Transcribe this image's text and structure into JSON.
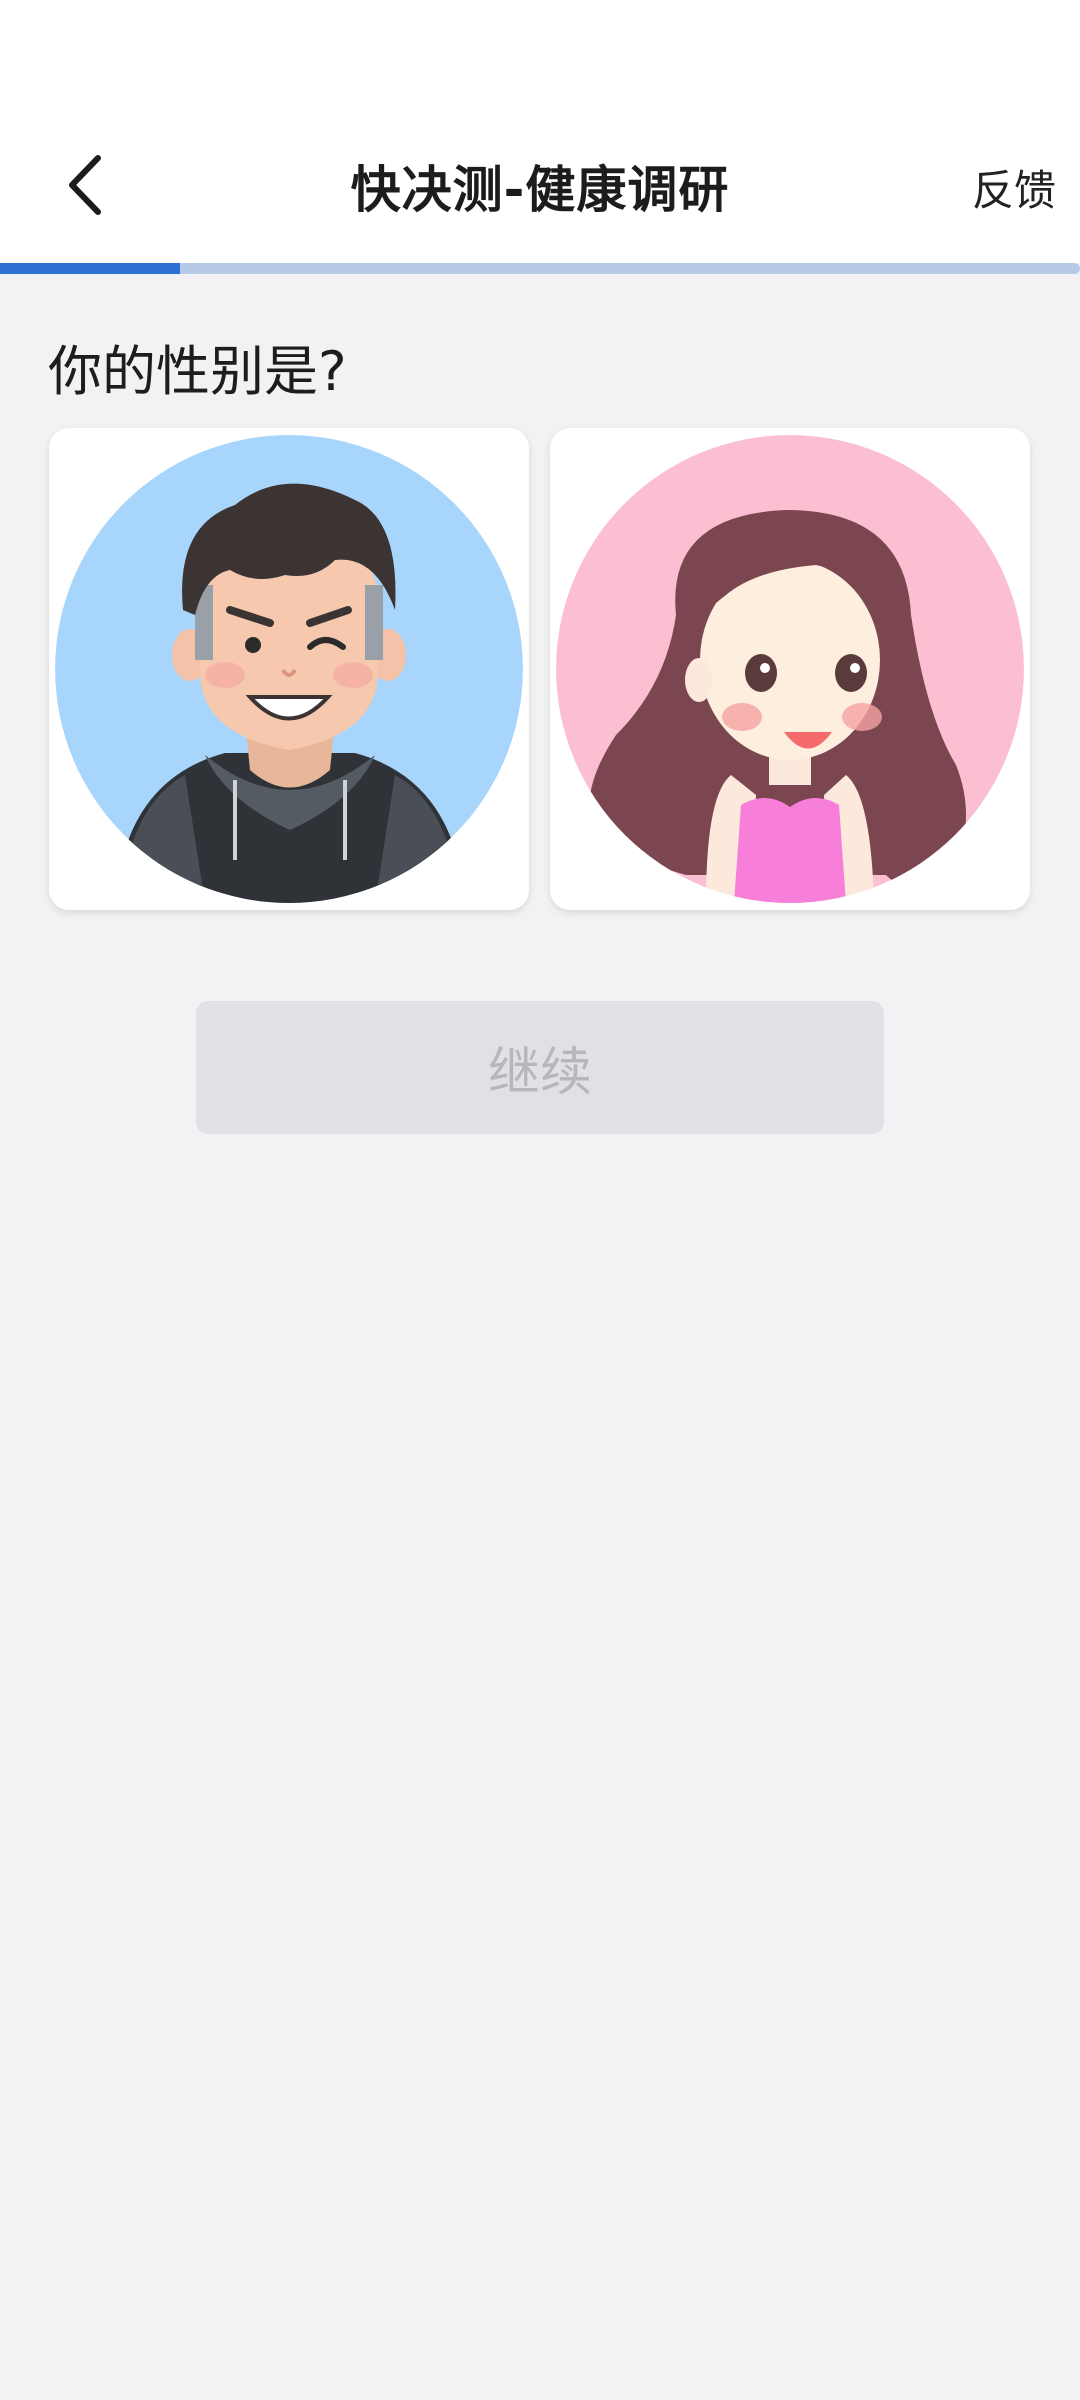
{
  "header": {
    "back_icon": "chevron-left-icon",
    "title": "快决测-健康调研",
    "feedback_label": "反馈"
  },
  "progress": {
    "value_fraction": 0.167,
    "fill_color": "#2d6fd2",
    "track_color": "#b6c9e6"
  },
  "question": {
    "text": "你的性别是?"
  },
  "options": [
    {
      "id": "male",
      "avatar": "male-avatar-icon",
      "bg_color": "#a8d5fb"
    },
    {
      "id": "female",
      "avatar": "female-avatar-icon",
      "bg_color": "#fbbfd1"
    }
  ],
  "continue_button": {
    "label": "继续",
    "state": "disabled"
  }
}
